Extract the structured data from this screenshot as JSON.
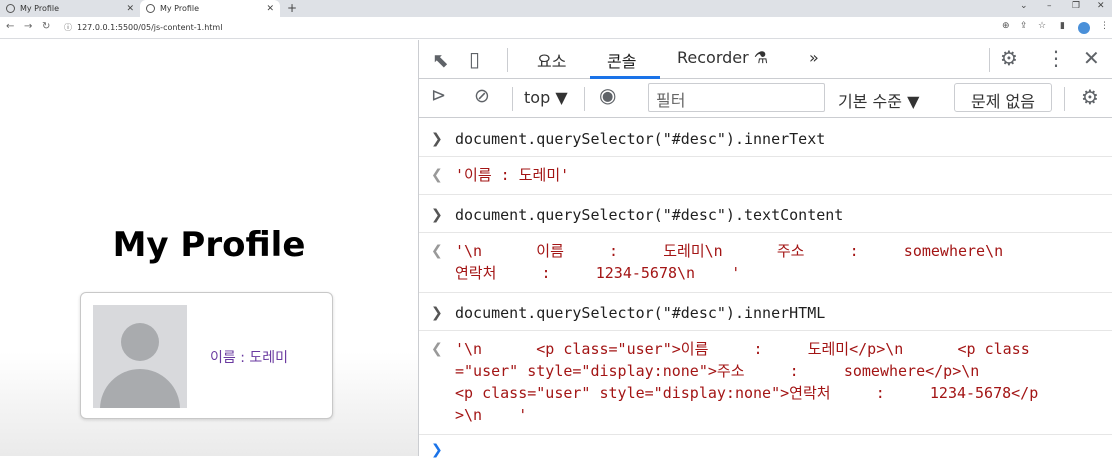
{
  "browser": {
    "tabs": [
      {
        "title": "My Profile",
        "active": false
      },
      {
        "title": "My Profile",
        "active": true
      }
    ],
    "url": "127.0.0.1:5500/05/js-content-1.html"
  },
  "page": {
    "title": "My Profile",
    "desc": "이름 : 도레미"
  },
  "devtools": {
    "tabs": [
      "요소",
      "콘솔",
      "Recorder"
    ],
    "active_tab": "콘솔",
    "context": "top",
    "filter_placeholder": "필터",
    "levels": "기본 수준",
    "issues": "문제 없음"
  },
  "console": {
    "entries": [
      {
        "type": "input",
        "lines": [
          "document.querySelector(\"#desc\").innerText"
        ]
      },
      {
        "type": "output",
        "lines": [
          "'이름 : 도레미'"
        ]
      },
      {
        "type": "input",
        "lines": [
          "document.querySelector(\"#desc\").textContent"
        ]
      },
      {
        "type": "output",
        "lines": [
          "'\\n      이름     :     도레미\\n      주소     :     somewhere\\n",
          "연락처     :     1234-5678\\n    '"
        ]
      },
      {
        "type": "input",
        "lines": [
          "document.querySelector(\"#desc\").innerHTML"
        ]
      },
      {
        "type": "output",
        "lines": [
          "'\\n      <p class=\"user\">이름     :     도레미</p>\\n      <p class",
          "=\"user\" style=\"display:none\">주소     :     somewhere</p>\\n",
          "<p class=\"user\" style=\"display:none\">연락처     :     1234-5678</p",
          ">\\n    '"
        ]
      }
    ]
  },
  "colors": {
    "accent": "#1a73e8",
    "string_output": "#a31515",
    "desc_text": "#6a3aa0"
  }
}
